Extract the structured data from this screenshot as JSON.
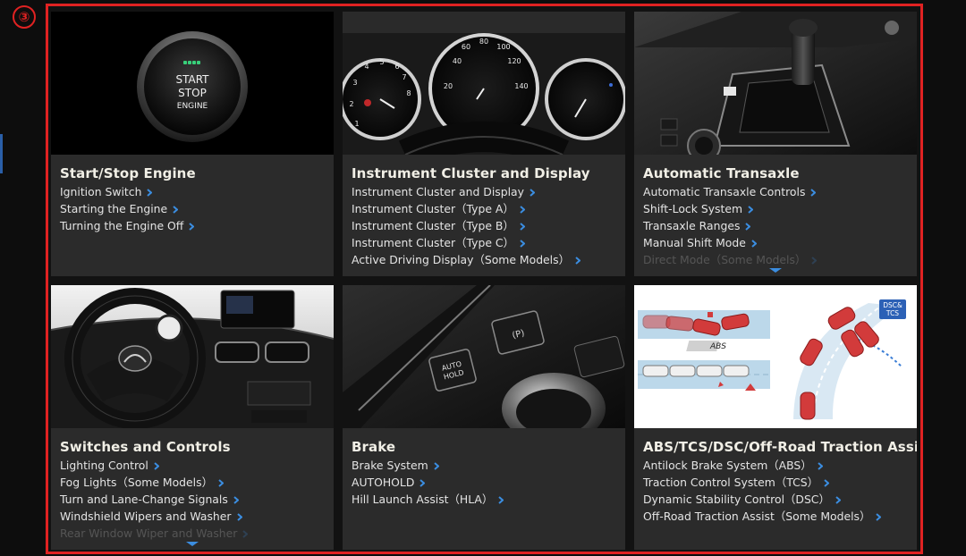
{
  "marker": "③",
  "colors": {
    "frame": "#e02222",
    "accent": "#3b8de0",
    "card_bg": "#2b2b2b"
  },
  "cards": [
    {
      "title": "Start/Stop Engine",
      "image": {
        "label_line1": "START",
        "label_line2": "STOP",
        "label_line3": "ENGINE"
      },
      "links": [
        "Ignition Switch",
        "Starting the Engine",
        "Turning the Engine Off"
      ],
      "faded": []
    },
    {
      "title": "Instrument Cluster and Display",
      "image": {
        "speed_ticks": [
          "20",
          "40",
          "60",
          "80",
          "100",
          "120",
          "140"
        ],
        "tach_ticks": [
          "1",
          "2",
          "3",
          "4",
          "5",
          "6",
          "7",
          "8"
        ]
      },
      "links": [
        "Instrument Cluster and Display",
        "Instrument Cluster（Type A）",
        "Instrument Cluster（Type B）",
        "Instrument Cluster（Type C）",
        "Active Driving Display（Some Models）"
      ],
      "faded": []
    },
    {
      "title": "Automatic Transaxle",
      "image": {},
      "links": [
        "Automatic Transaxle Controls",
        "Shift-Lock System",
        "Transaxle Ranges",
        "Manual Shift Mode"
      ],
      "faded": [
        "Direct Mode（Some Models）"
      ],
      "more": true
    },
    {
      "title": "Switches and Controls",
      "image": {},
      "links": [
        "Lighting Control",
        "Fog Lights（Some Models）",
        "Turn and Lane-Change Signals",
        "Windshield Wipers and Washer"
      ],
      "faded": [
        "Rear Window Wiper and Washer"
      ],
      "more": true
    },
    {
      "title": "Brake",
      "image": {
        "button_label_1": "AUTO",
        "button_label_2": "HOLD"
      },
      "links": [
        "Brake System",
        "AUTOHOLD",
        "Hill Launch Assist（HLA）"
      ],
      "faded": []
    },
    {
      "title": "ABS/TCS/DSC/Off-Road Traction Assist",
      "image": {
        "abs_label": "ABS",
        "badge_line1": "DSC&",
        "badge_line2": "TCS"
      },
      "links": [
        "Antilock Brake System（ABS）",
        "Traction Control System（TCS）",
        "Dynamic Stability Control（DSC）",
        "Off-Road Traction Assist（Some Models）"
      ],
      "faded": []
    }
  ]
}
